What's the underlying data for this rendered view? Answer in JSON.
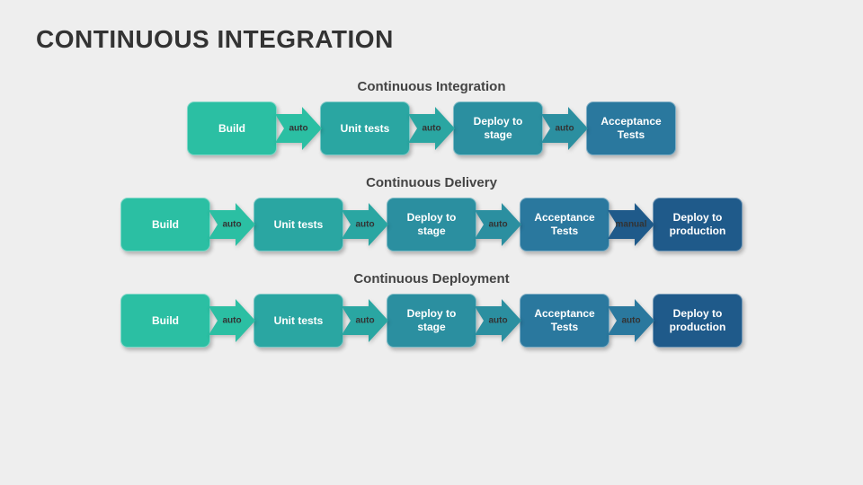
{
  "title": "CONTINUOUS INTEGRATION",
  "colors": {
    "c1": "#2bbfa3",
    "c2": "#2aa6a2",
    "c3": "#2b8fa0",
    "c4": "#2a789e",
    "c5": "#1f5a8a"
  },
  "flows": [
    {
      "title": "Continuous Integration",
      "steps": [
        {
          "label": "Build",
          "color": "c1"
        },
        {
          "label": "Unit tests",
          "color": "c2"
        },
        {
          "label": "Deploy to stage",
          "color": "c3"
        },
        {
          "label": "Acceptance Tests",
          "color": "c4"
        }
      ],
      "arrows": [
        {
          "label": "auto",
          "color": "c1"
        },
        {
          "label": "auto",
          "color": "c2"
        },
        {
          "label": "auto",
          "color": "c3"
        }
      ]
    },
    {
      "title": "Continuous Delivery",
      "steps": [
        {
          "label": "Build",
          "color": "c1"
        },
        {
          "label": "Unit tests",
          "color": "c2"
        },
        {
          "label": "Deploy to stage",
          "color": "c3"
        },
        {
          "label": "Acceptance Tests",
          "color": "c4"
        },
        {
          "label": "Deploy to production",
          "color": "c5"
        }
      ],
      "arrows": [
        {
          "label": "auto",
          "color": "c1"
        },
        {
          "label": "auto",
          "color": "c2"
        },
        {
          "label": "auto",
          "color": "c3"
        },
        {
          "label": "manual",
          "color": "c5"
        }
      ]
    },
    {
      "title": "Continuous Deployment",
      "steps": [
        {
          "label": "Build",
          "color": "c1"
        },
        {
          "label": "Unit tests",
          "color": "c2"
        },
        {
          "label": "Deploy to stage",
          "color": "c3"
        },
        {
          "label": "Acceptance Tests",
          "color": "c4"
        },
        {
          "label": "Deploy to production",
          "color": "c5"
        }
      ],
      "arrows": [
        {
          "label": "auto",
          "color": "c1"
        },
        {
          "label": "auto",
          "color": "c2"
        },
        {
          "label": "auto",
          "color": "c3"
        },
        {
          "label": "auto",
          "color": "c4"
        }
      ]
    }
  ]
}
